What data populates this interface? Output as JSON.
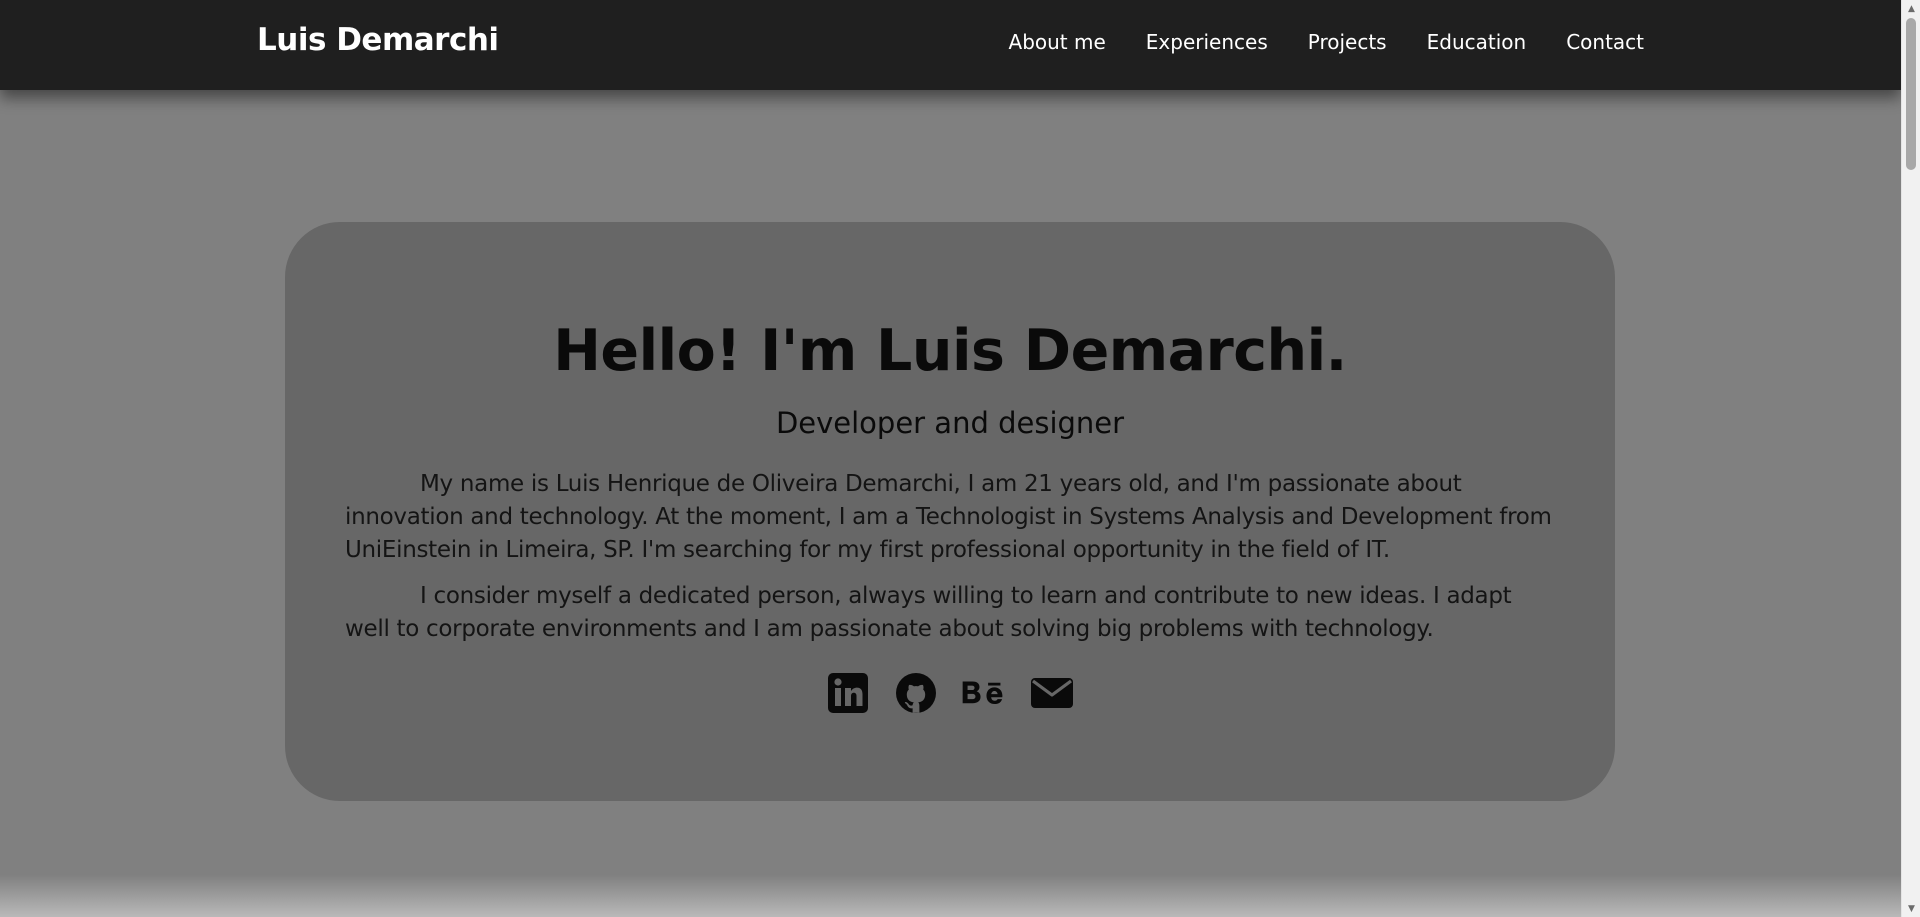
{
  "navbar": {
    "brand": "Luis Demarchi",
    "links": [
      "About me",
      "Experiences",
      "Projects",
      "Education",
      "Contact"
    ]
  },
  "hero": {
    "title": "Hello! I'm Luis Demarchi.",
    "subtitle": "Developer and designer",
    "paragraphs": [
      "My name is Luis Henrique de Oliveira Demarchi, I am 21 years old, and I'm passionate about innovation and technology. At the moment, I am a Technologist in Systems Analysis and Development from UniEinstein in Limeira, SP. I'm searching for my first professional opportunity in the field of IT.",
      "I consider myself a dedicated person, always willing to learn and contribute to new ideas. I adapt well to corporate environments and I am passionate about solving big problems with technology."
    ],
    "social_icons": [
      "linkedin-icon",
      "github-icon",
      "behance-icon",
      "email-icon"
    ]
  },
  "colors": {
    "navbar_bg": "#1f1f1f",
    "page_bg": "#808080",
    "card_bg": "#676767",
    "nav_text": "#ffffff",
    "card_text": "#0a0a0a"
  }
}
